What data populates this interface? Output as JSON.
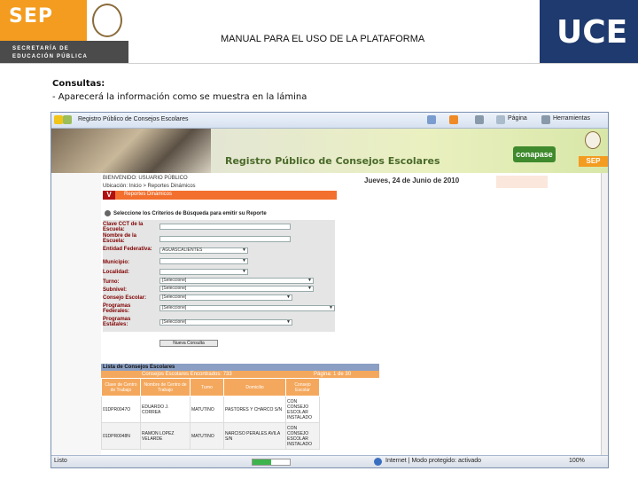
{
  "slide": {
    "sep_logo": "SEP",
    "sep_sub_line1": "SECRETARÍA DE",
    "sep_sub_line2": "EDUCACIÓN PÚBLICA",
    "title": "MANUAL PARA EL USO DE LA PLATAFORMA",
    "uce_logo": "UCE",
    "caption_title": "Consultas:",
    "caption_text": "- Aparecerá la información como se muestra en la lámina"
  },
  "browser": {
    "tab_title": "Registro Público de Consejos Escolares",
    "toolbar": {
      "page_label": "Página",
      "tools_label": "Herramientas"
    },
    "banner_title": "Registro Público de Consejos Escolares",
    "conapase_logo": "conapase",
    "sep_mini": "SEP",
    "status": {
      "left": "Listo",
      "mode": "Internet | Modo protegido: activado",
      "zoom": "100%"
    },
    "progress_fraction": 0.5
  },
  "page": {
    "welcome": "BIENVENIDO: USUARIO PÚBLICO",
    "location": "Ubicación: Inicio > Reportes Dinámicos",
    "date": "Jueves, 24 de Junio de 2010",
    "section_v": "V",
    "section_title": "Reportes Dinámicos",
    "criteria_title": "Seleccione los Criterios de Búsqueda para emitir su Reporte",
    "form": {
      "clave_cct": "Clave CCT de la Escuela:",
      "nombre_escuela": "Nombre de la Escuela:",
      "entidad": "Entidad Federativa:",
      "entidad_value": "AGUASCALIENTES",
      "municipio": "Municipio:",
      "localidad": "Localidad:",
      "turno": "Turno:",
      "turno_value": "[Seleccione]",
      "subnivel": "Subnivel:",
      "subnivel_value": "[Seleccione]",
      "consejo": "Consejo Escolar:",
      "consejo_value": "[Seleccione]",
      "prog_federales": "Programas Federales:",
      "prog_federales_value": "[Seleccione]",
      "prog_estatales": "Programas Estatales:",
      "prog_estatales_value": "[Seleccione]",
      "nueva_consulta": "Nueva Consulta"
    },
    "list": {
      "title": "Lista de Consejos Escolares",
      "found": "Consejos Escolares Encontrados: 733",
      "page": "Página: 1 de 30",
      "headers": [
        "Clave de Centro de Trabajo",
        "Nombre de Centro de Trabajo",
        "Turno",
        "Domicilio",
        "Consejo Escolar"
      ],
      "rows": [
        [
          "01DPR0047O",
          "EDUARDO J. CORREA",
          "MATUTINO",
          "PASTORES Y CHARCO S/N",
          "CON CONSEJO ESCOLAR INSTALADO"
        ],
        [
          "01DPR0048N",
          "RAMON LOPEZ VELARDE",
          "MATUTINO",
          "NARCISO PERALES AVILA S/N",
          "CON CONSEJO ESCOLAR INSTALADO"
        ]
      ]
    }
  }
}
